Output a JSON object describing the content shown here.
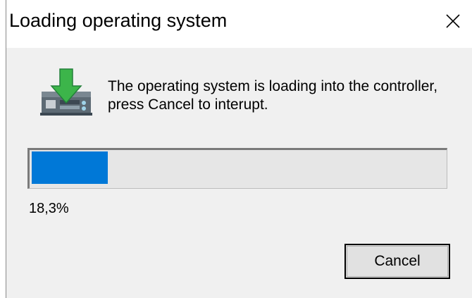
{
  "window": {
    "title": "Loading operating system",
    "close_icon": "close-x-icon"
  },
  "dialog": {
    "icon": "controller-download-icon",
    "message_line1": "The operating system is loading into the controller,",
    "message_line2": "press Cancel to interupt.",
    "progress_fraction": 0.183,
    "percent_label": "18,3%",
    "cancel_label": "Cancel"
  },
  "colors": {
    "progress_fill": "#0078d7",
    "arrow_green": "#3cb54a",
    "dialog_background": "#f0f0f0"
  }
}
